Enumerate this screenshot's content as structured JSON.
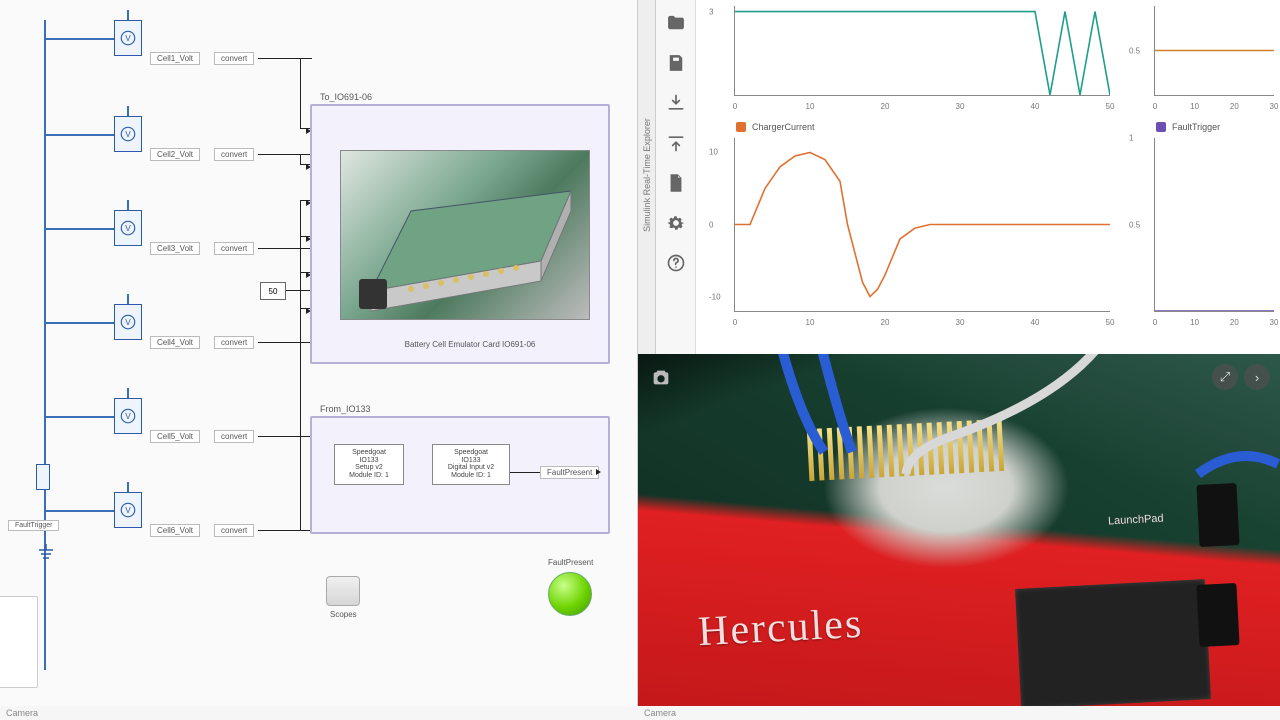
{
  "simulink": {
    "voltmeters": [
      "V",
      "V",
      "V",
      "V",
      "V",
      "V"
    ],
    "cell_labels": [
      "Cell1_Volt",
      "Cell2_Volt",
      "Cell3_Volt",
      "Cell4_Volt",
      "Cell5_Volt",
      "Cell6_Volt"
    ],
    "convert_labels": [
      "convert",
      "convert",
      "convert",
      "convert",
      "convert",
      "convert"
    ],
    "constant": "50",
    "fault_trigger_label": "FaultTrigger",
    "subsystem_to_title": "To_IO691-06",
    "emulator_caption": "Battery Cell Emulator Card IO691-06",
    "subsystem_from_title": "From_IO133",
    "from_block1_lines": [
      "Speedgoat",
      "IO133",
      "Setup v2",
      "Module ID: 1"
    ],
    "from_block2_lines": [
      "Speedgoat",
      "IO133",
      "Digital Input v2",
      "Module ID: 1"
    ],
    "fault_present_label": "FaultPresent",
    "fault_present_led": "FaultPresent",
    "scope_label": "Scopes"
  },
  "scope": {
    "side_tab": "Simulink Real-Time Explorer",
    "tool_icons": [
      "folder",
      "save",
      "download",
      "upload",
      "file",
      "gear",
      "help"
    ],
    "camera_label": "Camera"
  },
  "chart_data": [
    {
      "type": "line",
      "title": "",
      "series": [
        {
          "name": "",
          "color": "#1f9e8b",
          "x": [
            0,
            5,
            10,
            15,
            20,
            25,
            30,
            35,
            40,
            42,
            44,
            46,
            48,
            50
          ],
          "y": [
            3.0,
            3.0,
            3.0,
            3.0,
            3.0,
            3.0,
            3.0,
            3.0,
            3.0,
            0.0,
            3.0,
            0.0,
            3.0,
            0.0
          ]
        }
      ],
      "xlim": [
        0,
        50
      ],
      "ylim": [
        0,
        3.2
      ],
      "xticks": [
        0,
        10,
        20,
        30,
        40,
        50
      ],
      "yticks": [
        3
      ],
      "legend_name": ""
    },
    {
      "type": "line",
      "title": "",
      "series": [
        {
          "name": "",
          "color": "#d07f2e",
          "x": [
            0,
            10,
            20,
            30
          ],
          "y": [
            0.5,
            0.5,
            0.5,
            0.5
          ]
        }
      ],
      "xlim": [
        0,
        30
      ],
      "ylim": [
        0,
        1
      ],
      "xticks": [
        0,
        10,
        20,
        30
      ],
      "yticks": [
        0.5
      ],
      "legend_name": ""
    },
    {
      "type": "line",
      "title": "ChargerCurrent",
      "series": [
        {
          "name": "ChargerCurrent",
          "color": "#e07030",
          "x": [
            0,
            2,
            4,
            6,
            8,
            10,
            12,
            14,
            15,
            16,
            17,
            18,
            19,
            20,
            22,
            24,
            26,
            28,
            30,
            35,
            40,
            45,
            50
          ],
          "y": [
            0,
            0,
            5,
            8,
            9.5,
            10,
            9,
            6,
            0,
            -4,
            -8,
            -10,
            -9,
            -7,
            -2,
            -0.5,
            0,
            0,
            0,
            0,
            0,
            0,
            0
          ]
        }
      ],
      "xlim": [
        0,
        50
      ],
      "ylim": [
        -12,
        12
      ],
      "xticks": [
        0,
        10,
        20,
        30,
        40,
        50
      ],
      "yticks": [
        -10,
        0,
        10
      ],
      "legend_name": "ChargerCurrent",
      "legend_color": "#e07030"
    },
    {
      "type": "line",
      "title": "FaultTrigger",
      "series": [
        {
          "name": "FaultTrigger",
          "color": "#6b4fb3",
          "x": [
            0,
            5,
            10,
            15,
            20,
            25,
            30
          ],
          "y": [
            0,
            0,
            0,
            0,
            0,
            0,
            0
          ]
        }
      ],
      "xlim": [
        0,
        30
      ],
      "ylim": [
        0,
        1
      ],
      "xticks": [
        0,
        10,
        20,
        30
      ],
      "yticks": [
        0.5,
        1.0
      ],
      "legend_name": "FaultTrigger",
      "legend_color": "#6b4fb3"
    }
  ],
  "camera": {
    "board_name": "Hercules",
    "brand_hint": "LaunchPad"
  }
}
